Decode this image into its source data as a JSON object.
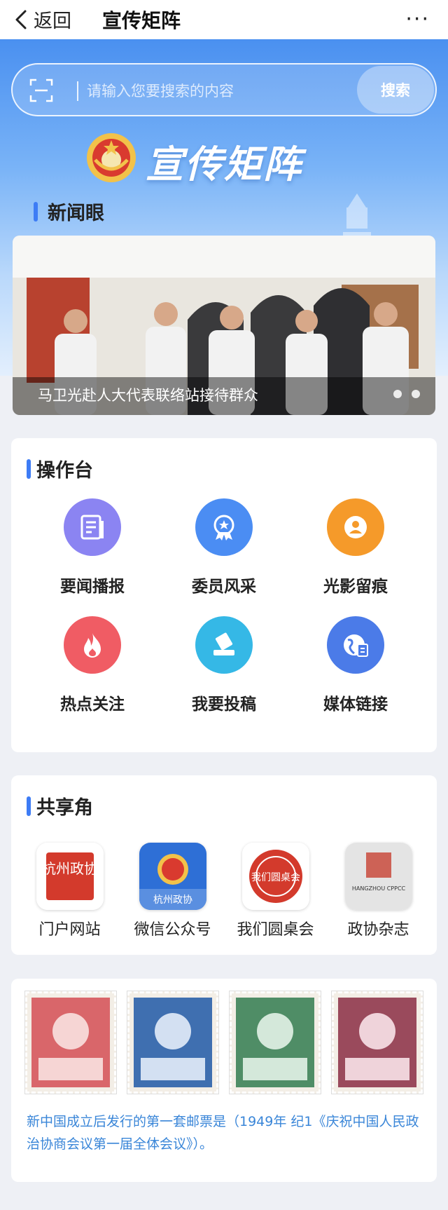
{
  "nav": {
    "back_label": "返回",
    "title": "宣传矩阵",
    "more": "···"
  },
  "search": {
    "placeholder": "请输入您要搜索的内容",
    "button": "搜索"
  },
  "banner": {
    "title": "宣传矩阵"
  },
  "news": {
    "heading": "新闻眼",
    "caption": "马卫光赴人大代表联络站接待群众",
    "slides": 2
  },
  "operations": {
    "heading": "操作台",
    "items": [
      {
        "label": "要闻播报",
        "icon": "news-document-icon",
        "color": "#8b84f2"
      },
      {
        "label": "委员风采",
        "icon": "award-badge-icon",
        "color": "#4b8df3"
      },
      {
        "label": "光影留痕",
        "icon": "user-portrait-icon",
        "color": "#f59a2a"
      },
      {
        "label": "热点关注",
        "icon": "flame-icon",
        "color": "#f05c64"
      },
      {
        "label": "我要投稿",
        "icon": "submit-tray-icon",
        "color": "#35b8e6"
      },
      {
        "label": "媒体链接",
        "icon": "globe-link-icon",
        "color": "#4b7be8"
      }
    ]
  },
  "share": {
    "heading": "共享角",
    "items": [
      {
        "label": "门户网站",
        "icon": "portal-seal-icon",
        "logo_text": "杭州政协"
      },
      {
        "label": "微信公众号",
        "icon": "wechat-official-icon",
        "logo_text": "杭州政协"
      },
      {
        "label": "我们圆桌会",
        "icon": "round-table-icon",
        "logo_text": "我们圆桌会"
      },
      {
        "label": "政协杂志",
        "icon": "magazine-icon",
        "logo_text": "HANGZHOU CPPCC"
      }
    ]
  },
  "stamps": {
    "colors": [
      "#d9666a",
      "#3f6fb0",
      "#4f8d66",
      "#9a4a5c"
    ],
    "description": "新中国成立后发行的第一套邮票是（1949年 纪1《庆祝中国人民政治协商会议第一届全体会议》）。"
  }
}
